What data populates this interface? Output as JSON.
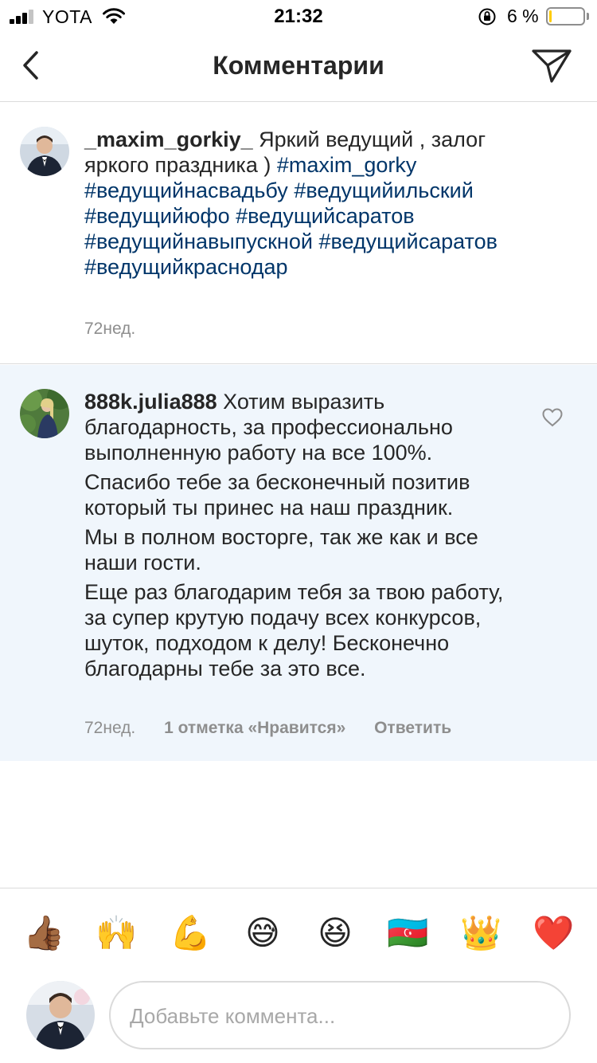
{
  "status_bar": {
    "carrier": "YOTA",
    "time": "21:32",
    "battery_percent": "6 %",
    "battery_level": 0.06,
    "battery_color": "#ffcc00"
  },
  "nav": {
    "title": "Комментарии",
    "back_icon": "chevron-left-icon",
    "send_icon": "paper-plane-icon"
  },
  "caption": {
    "username": "_maxim_gorkiy_",
    "text": " Яркий ведущий , залог яркого праздника )  ",
    "hashtags": [
      "#maxim_gorky",
      "#ведущийнасвадьбу",
      "#ведущийильский",
      "#ведущийюфо",
      "#ведущийсаратов",
      "#ведущийнавыпускной",
      "#ведущийсаратов",
      "#ведущийкраснодар"
    ],
    "time": "72нед."
  },
  "comment": {
    "username": "888k.julia888",
    "paragraphs": [
      " Хотим выразить благодарность, за профессионально выполненную работу на все 100%.",
      "Спасибо тебе за бесконечный позитив который ты принес на наш праздник.",
      "Мы в полном восторге, так же как и все наши гости.",
      "Еще раз благодарим тебя за твою работу, за супер крутую подачу всех конкурсов, шуток, подходом к делу! Бесконечно благодарны тебе за это все."
    ],
    "time": "72нед.",
    "likes": "1 отметка «Нравится»",
    "reply": "Ответить",
    "highlight_color": "#f0f6fc"
  },
  "emoji_bar": [
    {
      "glyph": "👍🏾",
      "name": "thumbs-up-emoji"
    },
    {
      "glyph": "🙌",
      "name": "raised-hands-emoji"
    },
    {
      "glyph": "💪",
      "name": "flexed-biceps-emoji"
    },
    {
      "glyph": "😅",
      "name": "grinning-sweat-emoji"
    },
    {
      "glyph": "😆",
      "name": "laughing-emoji"
    },
    {
      "glyph": "🇦🇿",
      "name": "azerbaijan-flag-emoji"
    },
    {
      "glyph": "👑",
      "name": "crown-emoji"
    },
    {
      "glyph": "❤️",
      "name": "red-heart-emoji"
    }
  ],
  "composer": {
    "placeholder": "Добавьте коммента..."
  },
  "colors": {
    "text": "#262626",
    "hashtag": "#003569",
    "secondary": "#8e8e8e",
    "divider": "#dbdbdb"
  }
}
